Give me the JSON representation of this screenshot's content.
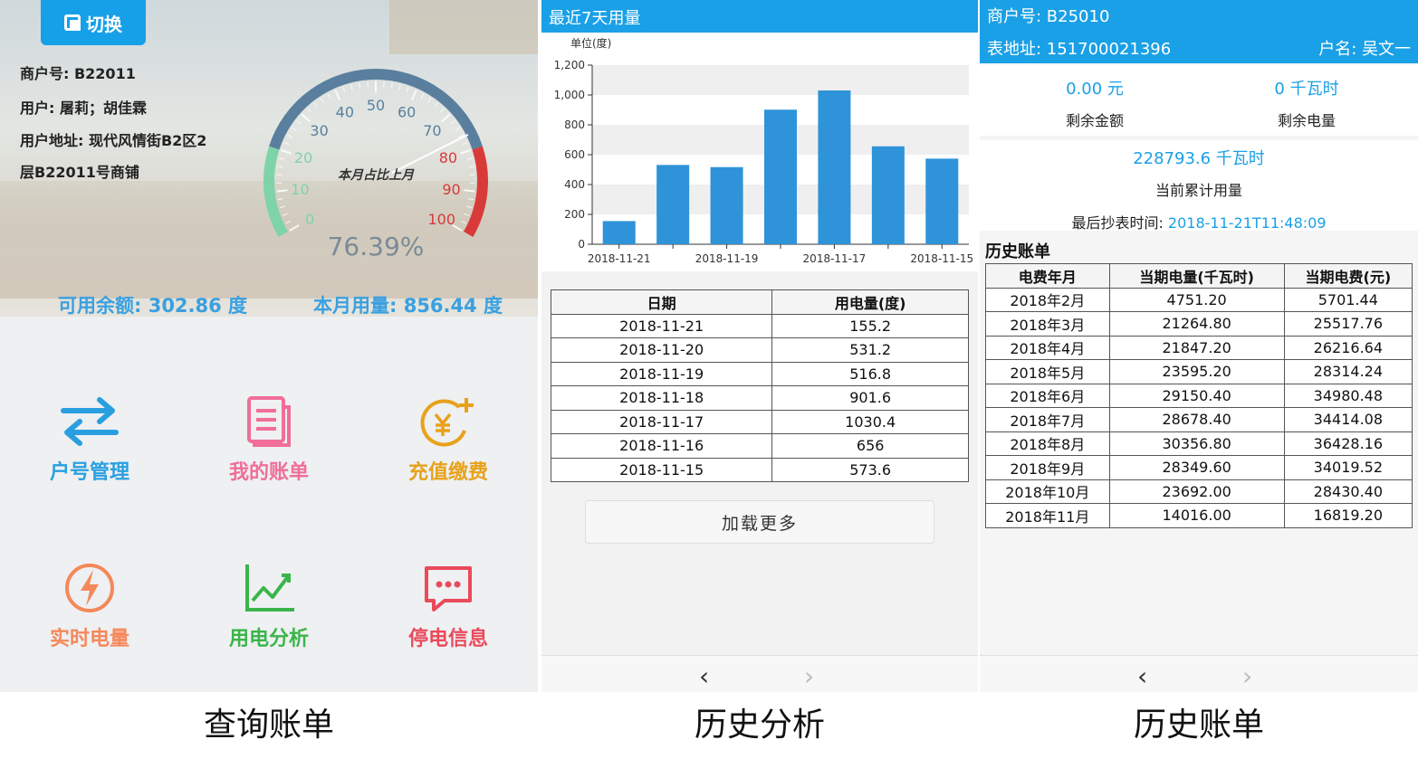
{
  "colors": {
    "primary": "#1aa0e6",
    "bar": "#2e93d9"
  },
  "panel1": {
    "switch_label": "切换",
    "merchant_no": "商户号: B22011",
    "user": "用户: 屠莉；胡佳霖",
    "address_line1": "用户地址: 现代风情街B2区2",
    "address_line2": "层B22011号商铺",
    "gauge": {
      "center_label": "本月占比上月",
      "percent_text": "76.39%",
      "percent_value": 76.39,
      "ticks": [
        "0",
        "10",
        "20",
        "30",
        "40",
        "50",
        "60",
        "70",
        "80",
        "90",
        "100"
      ]
    },
    "available_balance": "可用余额: 302.86 度",
    "month_usage": "本月用量: 856.44 度",
    "tiles": [
      {
        "label": "户号管理",
        "icon": "swap-arrows-icon",
        "color": "#2a9fe0"
      },
      {
        "label": "我的账单",
        "icon": "bill-document-icon",
        "color": "#f06e98"
      },
      {
        "label": "充值缴费",
        "icon": "yuan-coin-plus-icon",
        "color": "#e8a21a"
      },
      {
        "label": "实时电量",
        "icon": "lightning-circle-icon",
        "color": "#f5885a"
      },
      {
        "label": "用电分析",
        "icon": "line-chart-icon",
        "color": "#3ab54a"
      },
      {
        "label": "停电信息",
        "icon": "message-bubble-icon",
        "color": "#ea4a5a"
      }
    ],
    "caption": "查询账单"
  },
  "panel2": {
    "title": "最近7天用量",
    "table_headers": [
      "日期",
      "用电量(度)"
    ],
    "rows": [
      [
        "2018-11-21",
        "155.2"
      ],
      [
        "2018-11-20",
        "531.2"
      ],
      [
        "2018-11-19",
        "516.8"
      ],
      [
        "2018-11-18",
        "901.6"
      ],
      [
        "2018-11-17",
        "1030.4"
      ],
      [
        "2018-11-16",
        "656"
      ],
      [
        "2018-11-15",
        "573.6"
      ]
    ],
    "load_more": "加载更多",
    "nav_prev": "‹",
    "nav_next": "›",
    "caption": "历史分析"
  },
  "chart_data": {
    "type": "bar",
    "ylabel": "单位(度)",
    "categories": [
      "2018-11-21",
      "2018-11-20",
      "2018-11-19",
      "2018-11-18",
      "2018-11-17",
      "2018-11-16",
      "2018-11-15"
    ],
    "values": [
      155.2,
      531.2,
      516.8,
      901.6,
      1030.4,
      656,
      573.6
    ],
    "ylim": [
      0,
      1200
    ],
    "yticks": [
      "0",
      "200",
      "400",
      "600",
      "800",
      "1,000",
      "1,200"
    ],
    "yticks_values": [
      0,
      200,
      400,
      600,
      800,
      1000,
      1200
    ],
    "xtick_labels": [
      "2018-11-21",
      "2018-11-19",
      "2018-11-17",
      "2018-11-15"
    ],
    "grid": "horizontal bands"
  },
  "panel3": {
    "merchant_no": "商户号: B25010",
    "meter_address": "表地址: 151700021396",
    "account_name": "户名: 吴文一",
    "remaining_amount_value": "0.00 元",
    "remaining_amount_label": "剩余金额",
    "remaining_power_value": "0 千瓦时",
    "remaining_power_label": "剩余电量",
    "total_usage_value": "228793.6 千瓦时",
    "total_usage_label": "当前累计用量",
    "last_read_label": "最后抄表时间: ",
    "last_read_time": "2018-11-21T11:48:09",
    "history_title": "历史账单",
    "table_headers": [
      "电费年月",
      "当期电量(千瓦时)",
      "当期电费(元)"
    ],
    "rows": [
      [
        "2018年2月",
        "4751.20",
        "5701.44"
      ],
      [
        "2018年3月",
        "21264.80",
        "25517.76"
      ],
      [
        "2018年4月",
        "21847.20",
        "26216.64"
      ],
      [
        "2018年5月",
        "23595.20",
        "28314.24"
      ],
      [
        "2018年6月",
        "29150.40",
        "34980.48"
      ],
      [
        "2018年7月",
        "28678.40",
        "34414.08"
      ],
      [
        "2018年8月",
        "30356.80",
        "36428.16"
      ],
      [
        "2018年9月",
        "28349.60",
        "34019.52"
      ],
      [
        "2018年10月",
        "23692.00",
        "28430.40"
      ],
      [
        "2018年11月",
        "14016.00",
        "16819.20"
      ]
    ],
    "nav_prev": "‹",
    "nav_next": "›",
    "caption": "历史账单"
  }
}
